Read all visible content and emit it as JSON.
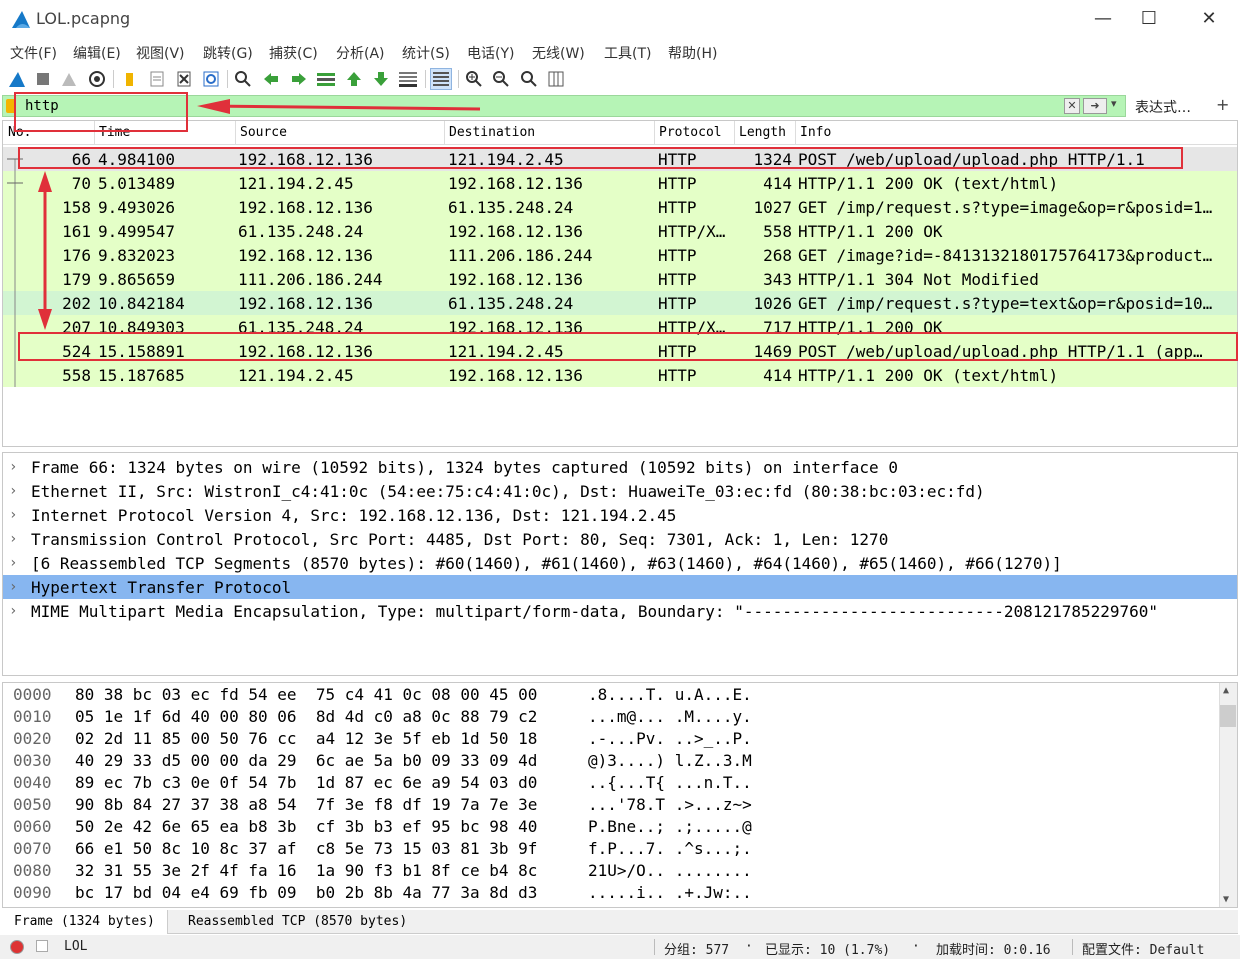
{
  "window": {
    "title": "LOL.pcapng",
    "minimize": "—",
    "maximize": "☐",
    "close": "✕"
  },
  "menu": [
    "文件(F)",
    "编辑(E)",
    "视图(V)",
    "跳转(G)",
    "捕获(C)",
    "分析(A)",
    "统计(S)",
    "电话(Y)",
    "无线(W)",
    "工具(T)",
    "帮助(H)"
  ],
  "toolbar_icons": [
    "shark-start-icon",
    "stop-icon",
    "restart-icon",
    "options-icon",
    "open-folder-icon",
    "file-icon",
    "close-file-icon",
    "reload-icon",
    "find-icon",
    "back-icon",
    "forward-icon",
    "go-to-icon",
    "first-icon",
    "last-icon",
    "autoscroll-icon",
    "colorize-icon",
    "zoom-in-icon",
    "zoom-out-icon",
    "zoom-reset-icon",
    "resize-columns-icon"
  ],
  "filter": {
    "value": "http",
    "expression_label": "表达式…",
    "plus": "+"
  },
  "columns": [
    "No.",
    "Time",
    "Source",
    "Destination",
    "Protocol",
    "Length",
    "Info"
  ],
  "packets": [
    {
      "no": "66",
      "time": "4.984100",
      "src": "192.168.12.136",
      "dst": "121.194.2.45",
      "proto": "HTTP",
      "len": "1324",
      "info": "POST /web/upload/upload.php HTTP/1.1",
      "bg": "#e6e6e6"
    },
    {
      "no": "70",
      "time": "5.013489",
      "src": "121.194.2.45",
      "dst": "192.168.12.136",
      "proto": "HTTP",
      "len": "414",
      "info": "HTTP/1.1 200 OK  (text/html)",
      "bg": "#e4ffc7"
    },
    {
      "no": "158",
      "time": "9.493026",
      "src": "192.168.12.136",
      "dst": "61.135.248.24",
      "proto": "HTTP",
      "len": "1027",
      "info": "GET /imp/request.s?type=image&op=r&posid=1…",
      "bg": "#e4ffc7"
    },
    {
      "no": "161",
      "time": "9.499547",
      "src": "61.135.248.24",
      "dst": "192.168.12.136",
      "proto": "HTTP/X…",
      "len": "558",
      "info": "HTTP/1.1 200 OK",
      "bg": "#e4ffc7"
    },
    {
      "no": "176",
      "time": "9.832023",
      "src": "192.168.12.136",
      "dst": "111.206.186.244",
      "proto": "HTTP",
      "len": "268",
      "info": "GET /image?id=-8413132180175764173&product…",
      "bg": "#e4ffc7"
    },
    {
      "no": "179",
      "time": "9.865659",
      "src": "111.206.186.244",
      "dst": "192.168.12.136",
      "proto": "HTTP",
      "len": "343",
      "info": "HTTP/1.1 304 Not Modified",
      "bg": "#e4ffc7"
    },
    {
      "no": "202",
      "time": "10.842184",
      "src": "192.168.12.136",
      "dst": "61.135.248.24",
      "proto": "HTTP",
      "len": "1026",
      "info": "GET /imp/request.s?type=text&op=r&posid=10…",
      "bg": "#d2f5d2"
    },
    {
      "no": "207",
      "time": "10.849303",
      "src": "61.135.248.24",
      "dst": "192.168.12.136",
      "proto": "HTTP/X…",
      "len": "717",
      "info": "HTTP/1.1 200 OK",
      "bg": "#e4ffc7"
    },
    {
      "no": "524",
      "time": "15.158891",
      "src": "192.168.12.136",
      "dst": "121.194.2.45",
      "proto": "HTTP",
      "len": "1469",
      "info": "POST /web/upload/upload.php HTTP/1.1  (app…",
      "bg": "#e4ffc7"
    },
    {
      "no": "558",
      "time": "15.187685",
      "src": "121.194.2.45",
      "dst": "192.168.12.136",
      "proto": "HTTP",
      "len": "414",
      "info": "HTTP/1.1 200 OK  (text/html)",
      "bg": "#e4ffc7"
    }
  ],
  "details": [
    {
      "text": "Frame 66: 1324 bytes on wire (10592 bits), 1324 bytes captured (10592 bits) on interface 0",
      "selected": false
    },
    {
      "text": "Ethernet II, Src: WistronI_c4:41:0c (54:ee:75:c4:41:0c), Dst: HuaweiTe_03:ec:fd (80:38:bc:03:ec:fd)",
      "selected": false
    },
    {
      "text": "Internet Protocol Version 4, Src: 192.168.12.136, Dst: 121.194.2.45",
      "selected": false
    },
    {
      "text": "Transmission Control Protocol, Src Port: 4485, Dst Port: 80, Seq: 7301, Ack: 1, Len: 1270",
      "selected": false
    },
    {
      "text": "[6 Reassembled TCP Segments (8570 bytes): #60(1460), #61(1460), #63(1460), #64(1460), #65(1460), #66(1270)]",
      "selected": false
    },
    {
      "text": "Hypertext Transfer Protocol",
      "selected": true
    },
    {
      "text": "MIME Multipart Media Encapsulation, Type: multipart/form-data, Boundary: \"---------------------------208121785229760\"",
      "selected": false
    }
  ],
  "bytes": [
    {
      "off": "0000",
      "hex": "80 38 bc 03 ec fd 54 ee  75 c4 41 0c 08 00 45 00",
      "asc": ".8....T. u.A...E."
    },
    {
      "off": "0010",
      "hex": "05 1e 1f 6d 40 00 80 06  8d 4d c0 a8 0c 88 79 c2",
      "asc": "...m@... .M....y."
    },
    {
      "off": "0020",
      "hex": "02 2d 11 85 00 50 76 cc  a4 12 3e 5f eb 1d 50 18",
      "asc": ".-...Pv. ..>_..P."
    },
    {
      "off": "0030",
      "hex": "40 29 33 d5 00 00 da 29  6c ae 5a b0 09 33 09 4d",
      "asc": "@)3....) l.Z..3.M"
    },
    {
      "off": "0040",
      "hex": "89 ec 7b c3 0e 0f 54 7b  1d 87 ec 6e a9 54 03 d0",
      "asc": "..{...T{ ...n.T.."
    },
    {
      "off": "0050",
      "hex": "90 8b 84 27 37 38 a8 54  7f 3e f8 df 19 7a 7e 3e",
      "asc": "...'78.T .>...z~>"
    },
    {
      "off": "0060",
      "hex": "50 2e 42 6e 65 ea b8 3b  cf 3b b3 ef 95 bc 98 40",
      "asc": "P.Bne..; .;.....@"
    },
    {
      "off": "0070",
      "hex": "66 e1 50 8c 10 8c 37 af  c8 5e 73 15 03 81 3b 9f",
      "asc": "f.P...7. .^s...;."
    },
    {
      "off": "0080",
      "hex": "32 31 55 3e 2f 4f fa 16  1a 90 f3 b1 8f ce b4 8c",
      "asc": "21U>/O.. ........"
    },
    {
      "off": "0090",
      "hex": "bc 17 bd 04 e4 69 fb 09  b0 2b 8b 4a 77 3a 8d d3",
      "asc": ".....i.. .+.Jw:.."
    }
  ],
  "bytes_tabs": [
    "Frame (1324 bytes)",
    "Reassembled TCP (8570 bytes)"
  ],
  "status": {
    "profile_name": "LOL",
    "packets": "分组: 577",
    "displayed": "已显示: 10 (1.7%)",
    "load_time": "加载时间: 0:0.16",
    "profile": "配置文件: Default"
  },
  "colors": {
    "selected_tree": "#87b6f0",
    "http_green": "#e4ffc7",
    "filter_bg": "#b6f4b6",
    "annotation_red": "#e0303a"
  }
}
